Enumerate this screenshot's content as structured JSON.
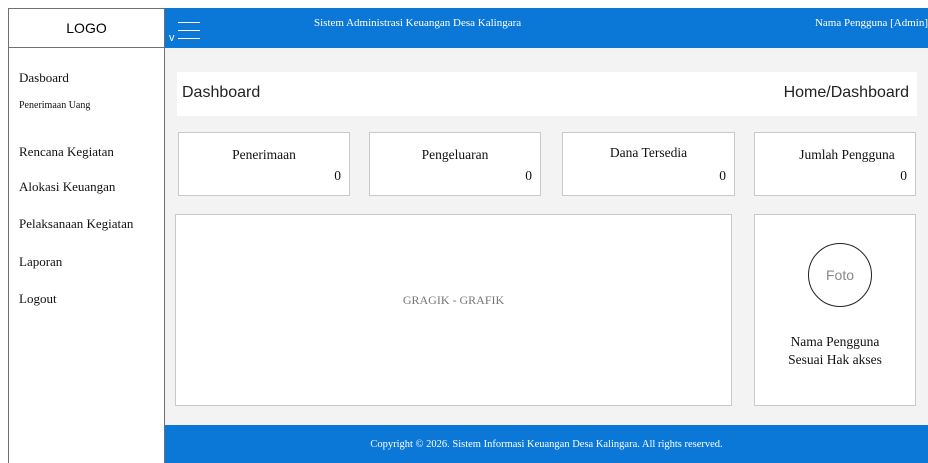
{
  "logo": {
    "text": "LOGO"
  },
  "topbar": {
    "toggle_label": "v",
    "title": "Sistem Administrasi Keuangan Desa Kalingara",
    "user": "Nama Pengguna [Admin]",
    "accent_color": "#0b78d8"
  },
  "sidebar": {
    "items": [
      {
        "label": "Dasboard"
      },
      {
        "label": "Penerimaan Uang"
      },
      {
        "label": "Rencana Kegiatan"
      },
      {
        "label": "Alokasi Keuangan"
      },
      {
        "label": "Pelaksanaan Kegiatan"
      },
      {
        "label": "Laporan"
      },
      {
        "label": "Logout"
      }
    ]
  },
  "header": {
    "title": "Dashboard",
    "breadcrumb": "Home/Dashboard"
  },
  "stats": [
    {
      "label": "Penerimaan",
      "value": "0"
    },
    {
      "label": "Pengeluaran",
      "value": "0"
    },
    {
      "label": "Dana Tersedia",
      "value": "0"
    },
    {
      "label": "Jumlah Pengguna",
      "value": "0"
    }
  ],
  "chart_panel": {
    "placeholder": "GRAGIK - GRAFIK"
  },
  "profile": {
    "avatar_label": "Foto",
    "name_line1": "Nama Pengguna",
    "name_line2": "Sesuai Hak akses"
  },
  "footer": {
    "text": "Copyright © 2026. Sistem Informasi Keuangan Desa Kalingara. All rights reserved."
  }
}
